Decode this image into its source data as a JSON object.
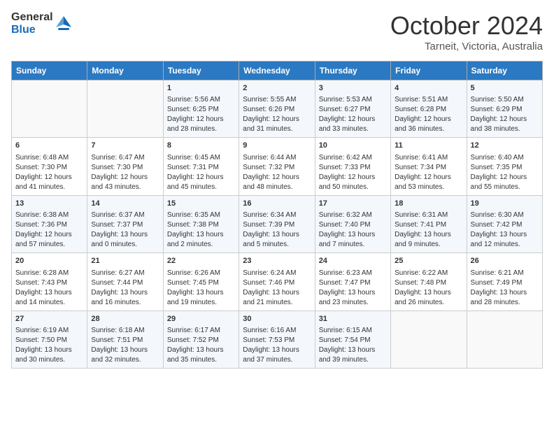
{
  "header": {
    "logo_line1": "General",
    "logo_line2": "Blue",
    "month": "October 2024",
    "location": "Tarneit, Victoria, Australia"
  },
  "days_of_week": [
    "Sunday",
    "Monday",
    "Tuesday",
    "Wednesday",
    "Thursday",
    "Friday",
    "Saturday"
  ],
  "weeks": [
    [
      {
        "day": "",
        "lines": []
      },
      {
        "day": "",
        "lines": []
      },
      {
        "day": "1",
        "lines": [
          "Sunrise: 5:56 AM",
          "Sunset: 6:25 PM",
          "Daylight: 12 hours",
          "and 28 minutes."
        ]
      },
      {
        "day": "2",
        "lines": [
          "Sunrise: 5:55 AM",
          "Sunset: 6:26 PM",
          "Daylight: 12 hours",
          "and 31 minutes."
        ]
      },
      {
        "day": "3",
        "lines": [
          "Sunrise: 5:53 AM",
          "Sunset: 6:27 PM",
          "Daylight: 12 hours",
          "and 33 minutes."
        ]
      },
      {
        "day": "4",
        "lines": [
          "Sunrise: 5:51 AM",
          "Sunset: 6:28 PM",
          "Daylight: 12 hours",
          "and 36 minutes."
        ]
      },
      {
        "day": "5",
        "lines": [
          "Sunrise: 5:50 AM",
          "Sunset: 6:29 PM",
          "Daylight: 12 hours",
          "and 38 minutes."
        ]
      }
    ],
    [
      {
        "day": "6",
        "lines": [
          "Sunrise: 6:48 AM",
          "Sunset: 7:30 PM",
          "Daylight: 12 hours",
          "and 41 minutes."
        ]
      },
      {
        "day": "7",
        "lines": [
          "Sunrise: 6:47 AM",
          "Sunset: 7:30 PM",
          "Daylight: 12 hours",
          "and 43 minutes."
        ]
      },
      {
        "day": "8",
        "lines": [
          "Sunrise: 6:45 AM",
          "Sunset: 7:31 PM",
          "Daylight: 12 hours",
          "and 45 minutes."
        ]
      },
      {
        "day": "9",
        "lines": [
          "Sunrise: 6:44 AM",
          "Sunset: 7:32 PM",
          "Daylight: 12 hours",
          "and 48 minutes."
        ]
      },
      {
        "day": "10",
        "lines": [
          "Sunrise: 6:42 AM",
          "Sunset: 7:33 PM",
          "Daylight: 12 hours",
          "and 50 minutes."
        ]
      },
      {
        "day": "11",
        "lines": [
          "Sunrise: 6:41 AM",
          "Sunset: 7:34 PM",
          "Daylight: 12 hours",
          "and 53 minutes."
        ]
      },
      {
        "day": "12",
        "lines": [
          "Sunrise: 6:40 AM",
          "Sunset: 7:35 PM",
          "Daylight: 12 hours",
          "and 55 minutes."
        ]
      }
    ],
    [
      {
        "day": "13",
        "lines": [
          "Sunrise: 6:38 AM",
          "Sunset: 7:36 PM",
          "Daylight: 12 hours",
          "and 57 minutes."
        ]
      },
      {
        "day": "14",
        "lines": [
          "Sunrise: 6:37 AM",
          "Sunset: 7:37 PM",
          "Daylight: 13 hours",
          "and 0 minutes."
        ]
      },
      {
        "day": "15",
        "lines": [
          "Sunrise: 6:35 AM",
          "Sunset: 7:38 PM",
          "Daylight: 13 hours",
          "and 2 minutes."
        ]
      },
      {
        "day": "16",
        "lines": [
          "Sunrise: 6:34 AM",
          "Sunset: 7:39 PM",
          "Daylight: 13 hours",
          "and 5 minutes."
        ]
      },
      {
        "day": "17",
        "lines": [
          "Sunrise: 6:32 AM",
          "Sunset: 7:40 PM",
          "Daylight: 13 hours",
          "and 7 minutes."
        ]
      },
      {
        "day": "18",
        "lines": [
          "Sunrise: 6:31 AM",
          "Sunset: 7:41 PM",
          "Daylight: 13 hours",
          "and 9 minutes."
        ]
      },
      {
        "day": "19",
        "lines": [
          "Sunrise: 6:30 AM",
          "Sunset: 7:42 PM",
          "Daylight: 13 hours",
          "and 12 minutes."
        ]
      }
    ],
    [
      {
        "day": "20",
        "lines": [
          "Sunrise: 6:28 AM",
          "Sunset: 7:43 PM",
          "Daylight: 13 hours",
          "and 14 minutes."
        ]
      },
      {
        "day": "21",
        "lines": [
          "Sunrise: 6:27 AM",
          "Sunset: 7:44 PM",
          "Daylight: 13 hours",
          "and 16 minutes."
        ]
      },
      {
        "day": "22",
        "lines": [
          "Sunrise: 6:26 AM",
          "Sunset: 7:45 PM",
          "Daylight: 13 hours",
          "and 19 minutes."
        ]
      },
      {
        "day": "23",
        "lines": [
          "Sunrise: 6:24 AM",
          "Sunset: 7:46 PM",
          "Daylight: 13 hours",
          "and 21 minutes."
        ]
      },
      {
        "day": "24",
        "lines": [
          "Sunrise: 6:23 AM",
          "Sunset: 7:47 PM",
          "Daylight: 13 hours",
          "and 23 minutes."
        ]
      },
      {
        "day": "25",
        "lines": [
          "Sunrise: 6:22 AM",
          "Sunset: 7:48 PM",
          "Daylight: 13 hours",
          "and 26 minutes."
        ]
      },
      {
        "day": "26",
        "lines": [
          "Sunrise: 6:21 AM",
          "Sunset: 7:49 PM",
          "Daylight: 13 hours",
          "and 28 minutes."
        ]
      }
    ],
    [
      {
        "day": "27",
        "lines": [
          "Sunrise: 6:19 AM",
          "Sunset: 7:50 PM",
          "Daylight: 13 hours",
          "and 30 minutes."
        ]
      },
      {
        "day": "28",
        "lines": [
          "Sunrise: 6:18 AM",
          "Sunset: 7:51 PM",
          "Daylight: 13 hours",
          "and 32 minutes."
        ]
      },
      {
        "day": "29",
        "lines": [
          "Sunrise: 6:17 AM",
          "Sunset: 7:52 PM",
          "Daylight: 13 hours",
          "and 35 minutes."
        ]
      },
      {
        "day": "30",
        "lines": [
          "Sunrise: 6:16 AM",
          "Sunset: 7:53 PM",
          "Daylight: 13 hours",
          "and 37 minutes."
        ]
      },
      {
        "day": "31",
        "lines": [
          "Sunrise: 6:15 AM",
          "Sunset: 7:54 PM",
          "Daylight: 13 hours",
          "and 39 minutes."
        ]
      },
      {
        "day": "",
        "lines": []
      },
      {
        "day": "",
        "lines": []
      }
    ]
  ]
}
